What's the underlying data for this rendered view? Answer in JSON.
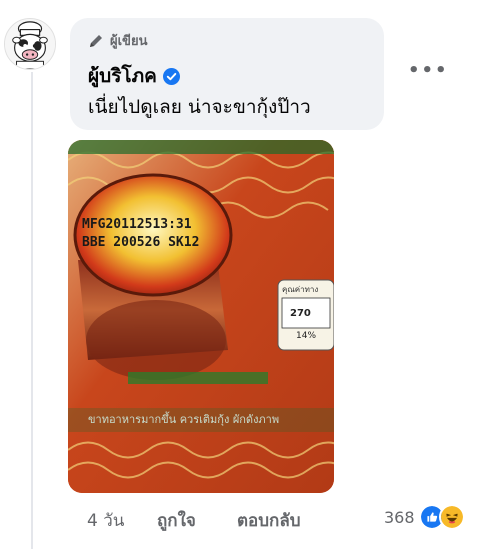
{
  "comment": {
    "author_badge": "ผู้เขียน",
    "commenter_name": "ผู้บริโภค",
    "text": "เนี่ยไปดูเลย น่าจะขากุ้งป๊าว",
    "more_icon": "more-options-icon",
    "verified_icon": "verified-check-icon"
  },
  "photo": {
    "mfg_line": "MFG20112513:31",
    "bbe_line": "BBE 200526 SK12",
    "package_text": "ขาทอาหารมากขึ้น ควรเติมกุ้ง ผักดังภาพ",
    "nutrition_label": "คุณค่าทาง",
    "nutrition_value": "270",
    "nutrition_percent": "14%"
  },
  "actions": {
    "time": "4 วัน",
    "like_label": "ถูกใจ",
    "reply_label": "ตอบกลับ",
    "reaction_count": "368",
    "reactions": [
      "like-reaction-icon",
      "haha-reaction-icon"
    ]
  },
  "colors": {
    "bubble_bg": "#f0f2f5",
    "text": "#050505",
    "secondary": "#65676b",
    "verified_blue": "#1877f2",
    "haha_yellow": "#f7b928"
  }
}
